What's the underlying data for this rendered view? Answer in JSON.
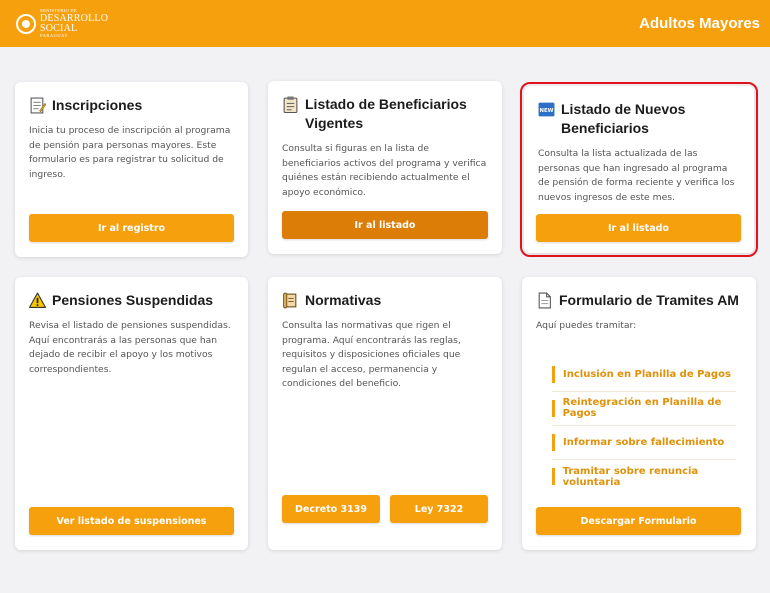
{
  "header": {
    "logo": {
      "line1": "MINISTERIO DE",
      "line2": "DESARROLLO",
      "line3": "SOCIAL",
      "line4": "PARAGUAY"
    },
    "title": "Adultos Mayores"
  },
  "colors": {
    "accent": "#f6a00e",
    "accent_dark": "#dc7d08",
    "highlight": "#e0131c"
  },
  "cards": {
    "inscripciones": {
      "icon": "memo-icon",
      "title": "Inscripciones",
      "desc": "Inicia tu proceso de inscripción al programa de pensión para personas mayores. Este formulario es para registrar tu solicitud de ingreso.",
      "button": "Ir al registro"
    },
    "vigentes": {
      "icon": "clipboard-icon",
      "title": "Listado de Beneficiarios Vigentes",
      "desc": "Consulta si figuras en la lista de beneficiarios activos del programa y verifica quiénes están recibiendo actualmente el apoyo económico.",
      "button": "Ir al listado"
    },
    "nuevos": {
      "icon": "new-badge-icon",
      "icon_text": "NEW",
      "title": "Listado de Nuevos Beneficiarios",
      "desc": "Consulta la lista actualizada de las personas que han ingresado al programa de pensión de forma reciente y verifica los nuevos ingresos de este mes.",
      "button": "Ir al listado"
    },
    "suspendidas": {
      "icon": "warning-icon",
      "title": "Pensiones Suspendidas",
      "desc": "Revisa el listado de pensiones suspendidas. Aquí encontrarás a las personas que han dejado de recibir el apoyo y los motivos correspondientes.",
      "button": "Ver listado de suspensiones"
    },
    "normativas": {
      "icon": "scroll-icon",
      "title": "Normativas",
      "desc": "Consulta las normativas que rigen el programa. Aquí encontrarás las reglas, requisitos y disposiciones oficiales que regulan el acceso, permanencia y condiciones del beneficio.",
      "button_1": "Decreto 3139",
      "button_2": "Ley 7322"
    },
    "tramites": {
      "icon": "document-icon",
      "title": "Formulario de Tramites AM",
      "desc": "Aquí puedes tramitar:",
      "items": [
        "Inclusión en Planilla de Pagos",
        "Reintegración en Planilla de Pagos",
        "Informar sobre fallecimiento",
        "Tramitar sobre renuncia voluntaria"
      ],
      "button": "Descargar Formulario"
    }
  }
}
